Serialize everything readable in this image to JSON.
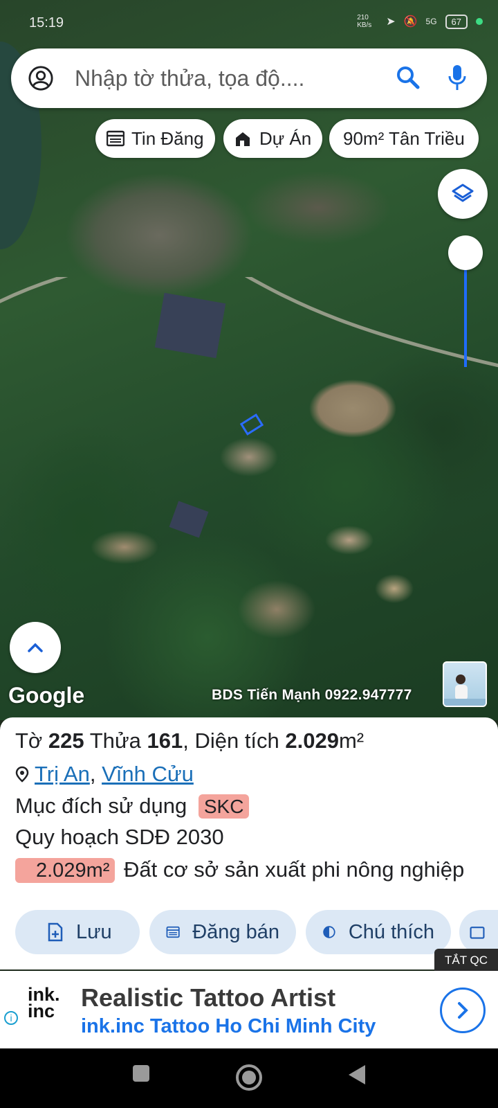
{
  "status_bar": {
    "time": "15:19",
    "speed": "210 KB/s",
    "network": "5G",
    "battery": "67",
    "accent_dot": "#3ddc84"
  },
  "search": {
    "placeholder": "Nhập tờ thửa, tọa độ....",
    "account_icon": "account-circle-icon",
    "search_icon": "search-icon",
    "mic_icon": "mic-icon"
  },
  "chips": {
    "listing": "Tin Đăng",
    "project": "Dự Án",
    "saved_query": "90m² Tân Triều"
  },
  "map": {
    "google_logo": "Google",
    "watermark": "BDS Tiến Mạnh 0922.947777",
    "highlight_color": "#2b6cff"
  },
  "parcel": {
    "sheet_label": "Tờ",
    "sheet_no": "225",
    "plot_label": "Thửa",
    "plot_no": "161",
    "area_label": ", Diện tích",
    "area": "2.029",
    "area_unit": "m²",
    "locality": "Trị An",
    "separator": ",",
    "district": "Vĩnh Cửu",
    "purpose_label": "Mục đích sử dụng",
    "purpose_code": "SKC",
    "plan_label": "Quy hoạch SDĐ 2030",
    "plan_area": "2.029m²",
    "plan_description": "Đất cơ sở sản xuất phi nông nghiệp",
    "tag_color": "#f4a49c"
  },
  "actions": {
    "save": "Lưu",
    "post_sale": "Đăng bán",
    "legend": "Chú thích"
  },
  "ad": {
    "close_label": "TẮT QC",
    "logo_line1": "ink.",
    "logo_line2": "inc",
    "title": "Realistic Tattoo Artist",
    "subtitle": "ink.inc Tattoo Ho Chi Minh City",
    "link_color": "#1a73e8"
  }
}
